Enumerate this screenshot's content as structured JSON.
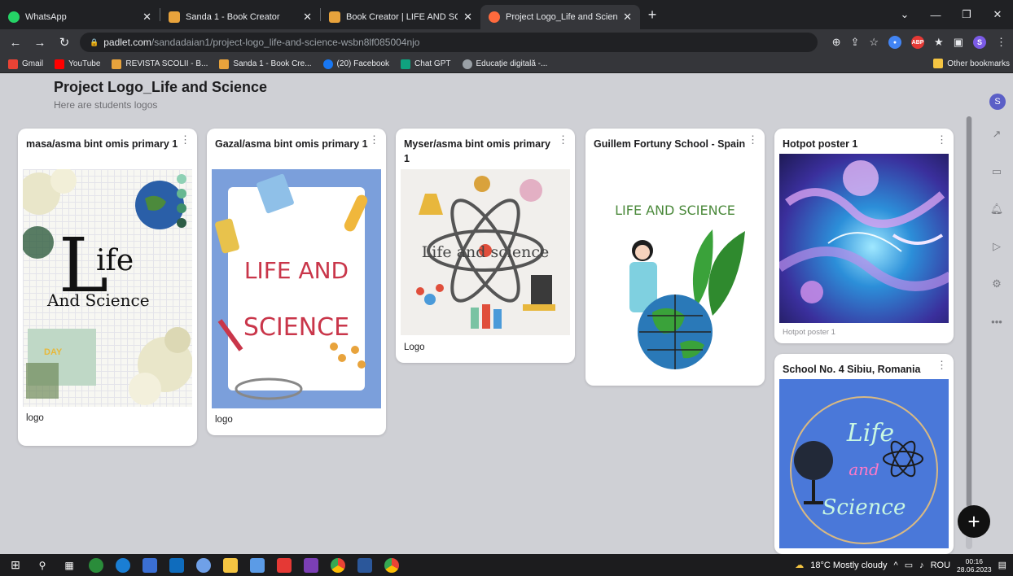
{
  "tabs": [
    {
      "title": "WhatsApp",
      "icon": "whatsapp-icon",
      "color": "#25d366"
    },
    {
      "title": "Sanda 1 - Book Creator",
      "icon": "book-creator-icon",
      "color": "#e8a33c"
    },
    {
      "title": "Book Creator | LIFE AND SCIENCE",
      "icon": "book-creator-icon",
      "color": "#e8a33c"
    },
    {
      "title": "Project Logo_Life and Science",
      "icon": "padlet-icon",
      "color": "#ff6a3d",
      "active": true
    }
  ],
  "address": {
    "host": "padlet.com",
    "path": "/sandadaian1/project-logo_life-and-science-wsbn8lf085004njo"
  },
  "bookmarks": [
    {
      "label": "Gmail",
      "color": "#ea4335"
    },
    {
      "label": "YouTube",
      "color": "#ff0000"
    },
    {
      "label": "REVISTA SCOLII - B...",
      "color": "#e8a33c"
    },
    {
      "label": "Sanda 1 - Book Cre...",
      "color": "#e8a33c"
    },
    {
      "label": "(20) Facebook",
      "color": "#1877f2"
    },
    {
      "label": "Chat GPT",
      "color": "#10a37f"
    },
    {
      "label": "Educație digitală -...",
      "color": "#9aa0a6"
    }
  ],
  "other_bookmarks": "Other bookmarks",
  "board": {
    "title": "Project Logo_Life and Science",
    "subtitle": "Here are students logos"
  },
  "posts": [
    {
      "title": "masa/asma bint omis primary 1",
      "caption": "logo",
      "image_text": [
        "ife",
        "And Science"
      ]
    },
    {
      "title": "Gazal/asma bint omis primary 1",
      "caption": "logo",
      "image_text": [
        "LIFE AND",
        "SCIENCE"
      ]
    },
    {
      "title": "Myser/asma bint omis primary 1",
      "caption": "Logo",
      "image_text": [
        "Life and science"
      ]
    },
    {
      "title": "Guillem Fortuny School - Spain",
      "caption": "",
      "image_text": [
        "LIFE AND SCIENCE"
      ]
    },
    {
      "title": "Hotpot poster 1",
      "caption": "Hotpot poster 1",
      "image_text": []
    },
    {
      "title": "School No. 4 Sibiu, Romania",
      "caption": "",
      "image_text": [
        "Life",
        "and",
        "Science"
      ]
    }
  ],
  "user_initial": "S",
  "taskbar": {
    "weather": "18°C  Mostly cloudy",
    "lang": "ROU",
    "time": "00:16",
    "date": "28.06.2023"
  }
}
